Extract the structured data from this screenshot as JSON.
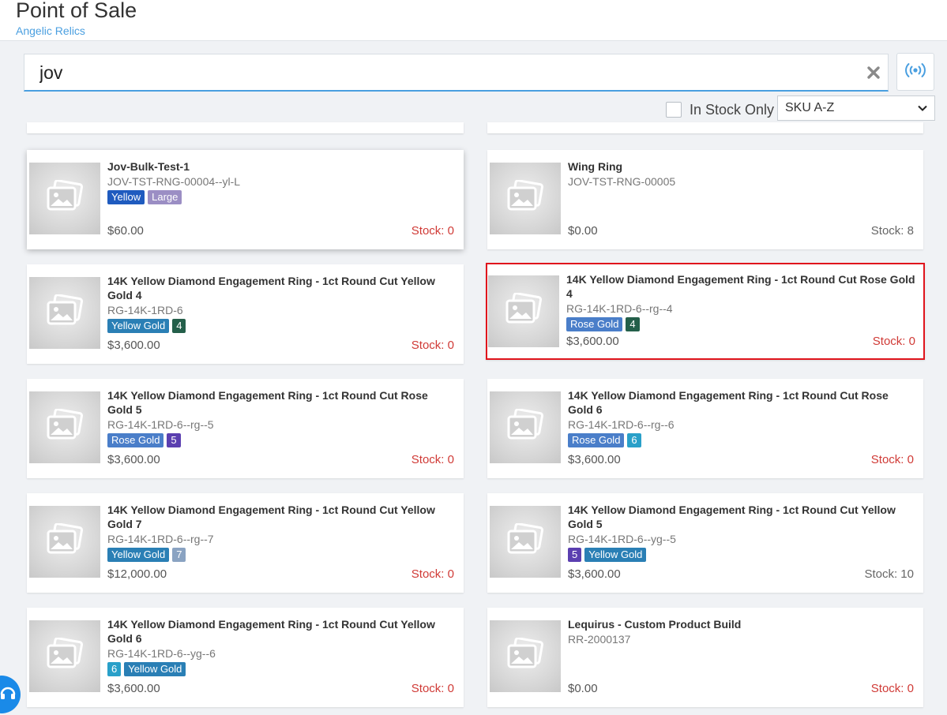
{
  "header": {
    "title": "Point of Sale",
    "subtitle": "Angelic Relics"
  },
  "search": {
    "value": "jov",
    "clear_icon": "close-x-icon"
  },
  "scan_button": {
    "icon": "broadcast-signal-icon",
    "color": "#4a9fe0"
  },
  "filters": {
    "in_stock_label": "In Stock Only",
    "in_stock_checked": false,
    "sort_value": "SKU A-Z"
  },
  "colors": {
    "stock_zero": "#d03a36",
    "stock_positive": "#666666",
    "accent": "#4a9fe0",
    "selected_border": "#e0141c"
  },
  "products": [
    {
      "name": "Jov-Bulk-Test-1",
      "sku": "JOV-TST-RNG-00004--yl-L",
      "badges": [
        {
          "text": "Yellow",
          "color": "#1f5bbf"
        },
        {
          "text": "Large",
          "color": "#9b8ec4"
        }
      ],
      "price": "$60.00",
      "stock": "Stock: 0",
      "stock_zero": true,
      "hover": true
    },
    {
      "name": "Wing Ring",
      "sku": "JOV-TST-RNG-00005",
      "badges": [],
      "price": "$0.00",
      "stock": "Stock: 8",
      "stock_zero": false
    },
    {
      "name": "14K Yellow Diamond Engagement Ring - 1ct Round Cut Yellow Gold 4",
      "sku": "RG-14K-1RD-6",
      "badges": [
        {
          "text": "Yellow Gold",
          "color": "#2a7fb5"
        },
        {
          "text": "4",
          "color": "#245f4a"
        }
      ],
      "price": "$3,600.00",
      "stock": "Stock: 0",
      "stock_zero": true
    },
    {
      "name": "14K Yellow Diamond Engagement Ring - 1ct Round Cut Rose Gold 4",
      "sku": "RG-14K-1RD-6--rg--4",
      "badges": [
        {
          "text": "Rose Gold",
          "color": "#4a7ec9"
        },
        {
          "text": "4",
          "color": "#245f4a"
        }
      ],
      "price": "$3,600.00",
      "stock": "Stock: 0",
      "stock_zero": true,
      "selected": true
    },
    {
      "name": "14K Yellow Diamond Engagement Ring - 1ct Round Cut Rose Gold 5",
      "sku": "RG-14K-1RD-6--rg--5",
      "badges": [
        {
          "text": "Rose Gold",
          "color": "#4a7ec9"
        },
        {
          "text": "5",
          "color": "#5b3fb0"
        }
      ],
      "price": "$3,600.00",
      "stock": "Stock: 0",
      "stock_zero": true
    },
    {
      "name": "14K Yellow Diamond Engagement Ring - 1ct Round Cut Rose Gold 6",
      "sku": "RG-14K-1RD-6--rg--6",
      "badges": [
        {
          "text": "Rose Gold",
          "color": "#4a7ec9"
        },
        {
          "text": "6",
          "color": "#29a0c9"
        }
      ],
      "price": "$3,600.00",
      "stock": "Stock: 0",
      "stock_zero": true
    },
    {
      "name": "14K Yellow Diamond Engagement Ring - 1ct Round Cut Yellow Gold 7",
      "sku": "RG-14K-1RD-6--rg--7",
      "badges": [
        {
          "text": "Yellow Gold",
          "color": "#2a7fb5"
        },
        {
          "text": "7",
          "color": "#8aa3c2"
        }
      ],
      "price": "$12,000.00",
      "stock": "Stock: 0",
      "stock_zero": true
    },
    {
      "name": "14K Yellow Diamond Engagement Ring - 1ct Round Cut Yellow Gold 5",
      "sku": "RG-14K-1RD-6--yg--5",
      "badges": [
        {
          "text": "5",
          "color": "#5b3fb0"
        },
        {
          "text": "Yellow Gold",
          "color": "#2a7fb5"
        }
      ],
      "price": "$3,600.00",
      "stock": "Stock: 10",
      "stock_zero": false
    },
    {
      "name": "14K Yellow Diamond Engagement Ring - 1ct Round Cut Yellow Gold 6",
      "sku": "RG-14K-1RD-6--yg--6",
      "badges": [
        {
          "text": "6",
          "color": "#29a0c9"
        },
        {
          "text": "Yellow Gold",
          "color": "#2a7fb5"
        }
      ],
      "price": "$3,600.00",
      "stock": "Stock: 0",
      "stock_zero": true
    },
    {
      "name": "Lequirus - Custom Product Build",
      "sku": "RR-2000137",
      "badges": [],
      "price": "$0.00",
      "stock": "Stock: 0",
      "stock_zero": true
    }
  ],
  "help_bubble": {
    "icon": "help-chat-icon"
  }
}
